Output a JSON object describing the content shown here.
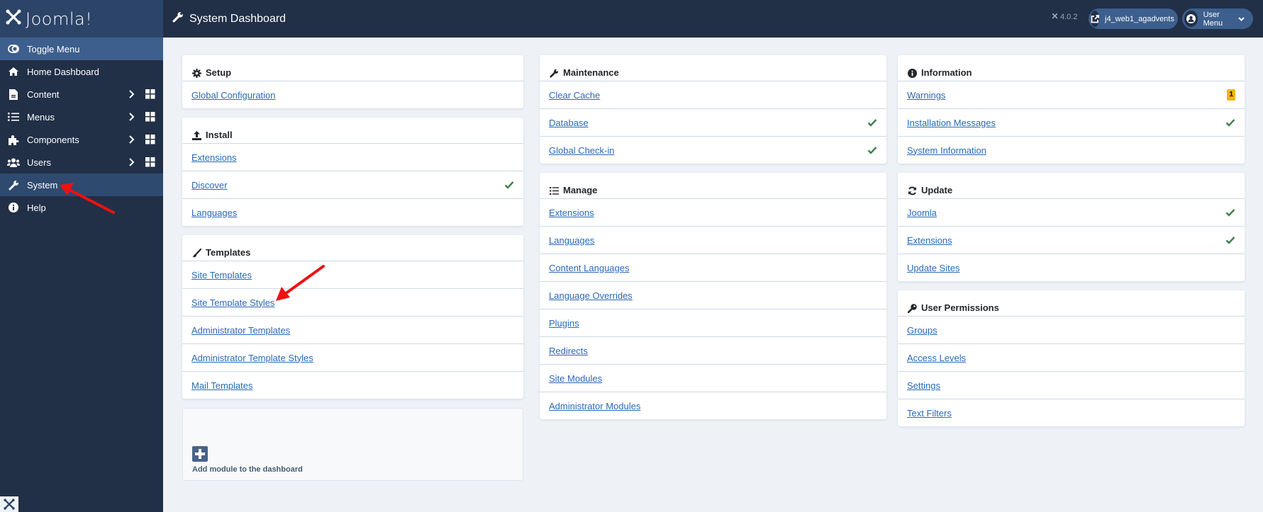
{
  "app": {
    "brand": "Joomla!",
    "version": "4.0.2",
    "page_title": "System Dashboard"
  },
  "header": {
    "site_link_label": "j4_web1_agadvents",
    "user_menu_label": "User Menu"
  },
  "sidebar": {
    "items": [
      {
        "label": "Toggle Menu",
        "icon": "toggle-icon"
      },
      {
        "label": "Home Dashboard",
        "icon": "home-icon"
      },
      {
        "label": "Content",
        "icon": "file-icon",
        "expandable": true
      },
      {
        "label": "Menus",
        "icon": "list-icon",
        "expandable": true
      },
      {
        "label": "Components",
        "icon": "puzzle-icon",
        "expandable": true
      },
      {
        "label": "Users",
        "icon": "users-icon",
        "expandable": true
      },
      {
        "label": "System",
        "icon": "wrench-icon",
        "active": true
      },
      {
        "label": "Help",
        "icon": "info-icon"
      }
    ]
  },
  "cards": {
    "setup": {
      "title": "Setup",
      "links": [
        {
          "label": "Global Configuration"
        }
      ]
    },
    "install": {
      "title": "Install",
      "links": [
        {
          "label": "Extensions"
        },
        {
          "label": "Discover",
          "status": "check"
        },
        {
          "label": "Languages"
        }
      ]
    },
    "templates": {
      "title": "Templates",
      "links": [
        {
          "label": "Site Templates"
        },
        {
          "label": "Site Template Styles"
        },
        {
          "label": "Administrator Templates"
        },
        {
          "label": "Administrator Template Styles"
        },
        {
          "label": "Mail Templates"
        }
      ]
    },
    "maintenance": {
      "title": "Maintenance",
      "links": [
        {
          "label": "Clear Cache"
        },
        {
          "label": "Database",
          "status": "check"
        },
        {
          "label": "Global Check-in",
          "status": "check"
        }
      ]
    },
    "manage": {
      "title": "Manage",
      "links": [
        {
          "label": "Extensions"
        },
        {
          "label": "Languages"
        },
        {
          "label": "Content Languages"
        },
        {
          "label": "Language Overrides"
        },
        {
          "label": "Plugins"
        },
        {
          "label": "Redirects"
        },
        {
          "label": "Site Modules"
        },
        {
          "label": "Administrator Modules"
        }
      ]
    },
    "information": {
      "title": "Information",
      "links": [
        {
          "label": "Warnings",
          "badge": "1"
        },
        {
          "label": "Installation Messages",
          "status": "check"
        },
        {
          "label": "System Information"
        }
      ]
    },
    "update": {
      "title": "Update",
      "links": [
        {
          "label": "Joomla",
          "status": "check"
        },
        {
          "label": "Extensions",
          "status": "check"
        },
        {
          "label": "Update Sites"
        }
      ]
    },
    "permissions": {
      "title": "User Permissions",
      "links": [
        {
          "label": "Groups"
        },
        {
          "label": "Access Levels"
        },
        {
          "label": "Settings"
        },
        {
          "label": "Text Filters"
        }
      ]
    }
  },
  "add_module": {
    "label": "Add module to the dashboard"
  },
  "colors": {
    "sidebar_bg": "#212f47",
    "toggle_bg": "#3c5f8d",
    "active_bg": "#2e4a6f",
    "link": "#2a69b8",
    "check": "#3d7f4b",
    "badge": "#f5b400",
    "annotation_arrow": "#ee1111"
  }
}
